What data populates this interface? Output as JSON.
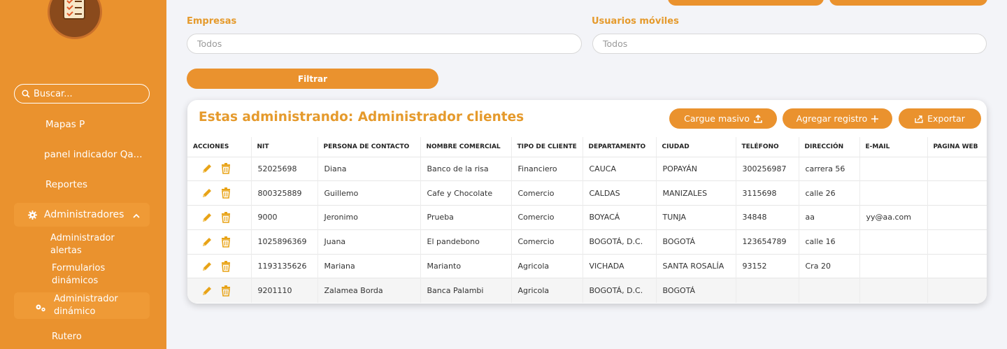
{
  "sidebar": {
    "search_placeholder": "Buscar...",
    "items": [
      {
        "label": "Mapas P"
      },
      {
        "label": "panel indicador Qa..."
      },
      {
        "label": "Reportes"
      }
    ],
    "admin": {
      "label": "Administradores"
    },
    "subitems": [
      {
        "label_line1": "Administrador",
        "label_line2": "alertas"
      },
      {
        "label_line1": "Formularios",
        "label_line2": "dinámicos"
      },
      {
        "label_line1": "Administrador",
        "label_line2": "dinámico"
      },
      {
        "label_line1": "Rutero",
        "label_line2": ""
      }
    ]
  },
  "filters": {
    "empresas_label": "Empresas",
    "empresas_value": "Todos",
    "usuarios_label": "Usuarios móviles",
    "usuarios_value": "Todos",
    "filter_button": "Filtrar"
  },
  "card": {
    "title": "Estas administrando: Administrador clientes",
    "bulk_button": "Cargue masivo",
    "add_button": "Agregar registro",
    "export_button": "Exportar"
  },
  "table": {
    "headers": [
      "ACCIONES",
      "NIT",
      "PERSONA DE CONTACTO",
      "NOMBRE COMERCIAL",
      "TIPO DE CLIENTE",
      "DEPARTAMENTO",
      "CIUDAD",
      "TELÉFONO",
      "DIRECCIÓN",
      "E-MAIL",
      "PAGINA WEB"
    ],
    "rows": [
      [
        "52025698",
        "Diana",
        "Banco de la risa",
        "Financiero",
        "CAUCA",
        "POPAYÁN",
        "300256987",
        "carrera 56",
        "",
        ""
      ],
      [
        "800325889",
        "Guillemo",
        "Cafe y Chocolate",
        "Comercio",
        "CALDAS",
        "MANIZALES",
        "3115698",
        "calle 26",
        "",
        ""
      ],
      [
        "9000",
        "Jeronimo",
        "Prueba",
        "Comercio",
        "BOYACÁ",
        "TUNJA",
        "34848",
        "aa",
        "yy@aa.com",
        ""
      ],
      [
        "1025896369",
        "Juana",
        "El pandebono",
        "Comercio",
        "BOGOTÁ, D.C.",
        "BOGOTÁ",
        "123654789",
        "calle 16",
        "",
        ""
      ],
      [
        "1193135626",
        "Mariana",
        "Marianto",
        "Agricola",
        "VICHADA",
        "SANTA ROSALÍA",
        "93152",
        "Cra 20",
        "",
        ""
      ],
      [
        "9201110",
        "Zalamea Borda",
        "Banca Palambi",
        "Agricola",
        "BOGOTÁ, D.C.",
        "BOGOTÁ",
        "",
        "",
        "",
        ""
      ]
    ]
  },
  "colors": {
    "accent": "#ea922e",
    "title": "#e59a2c",
    "background": "#f3f4f8"
  },
  "icons": {
    "search": "search-icon",
    "gear": "gear-icon",
    "edit": "pencil-icon",
    "delete": "trash-icon",
    "upload": "upload-icon",
    "plus": "plus-icon",
    "export": "export-icon"
  }
}
